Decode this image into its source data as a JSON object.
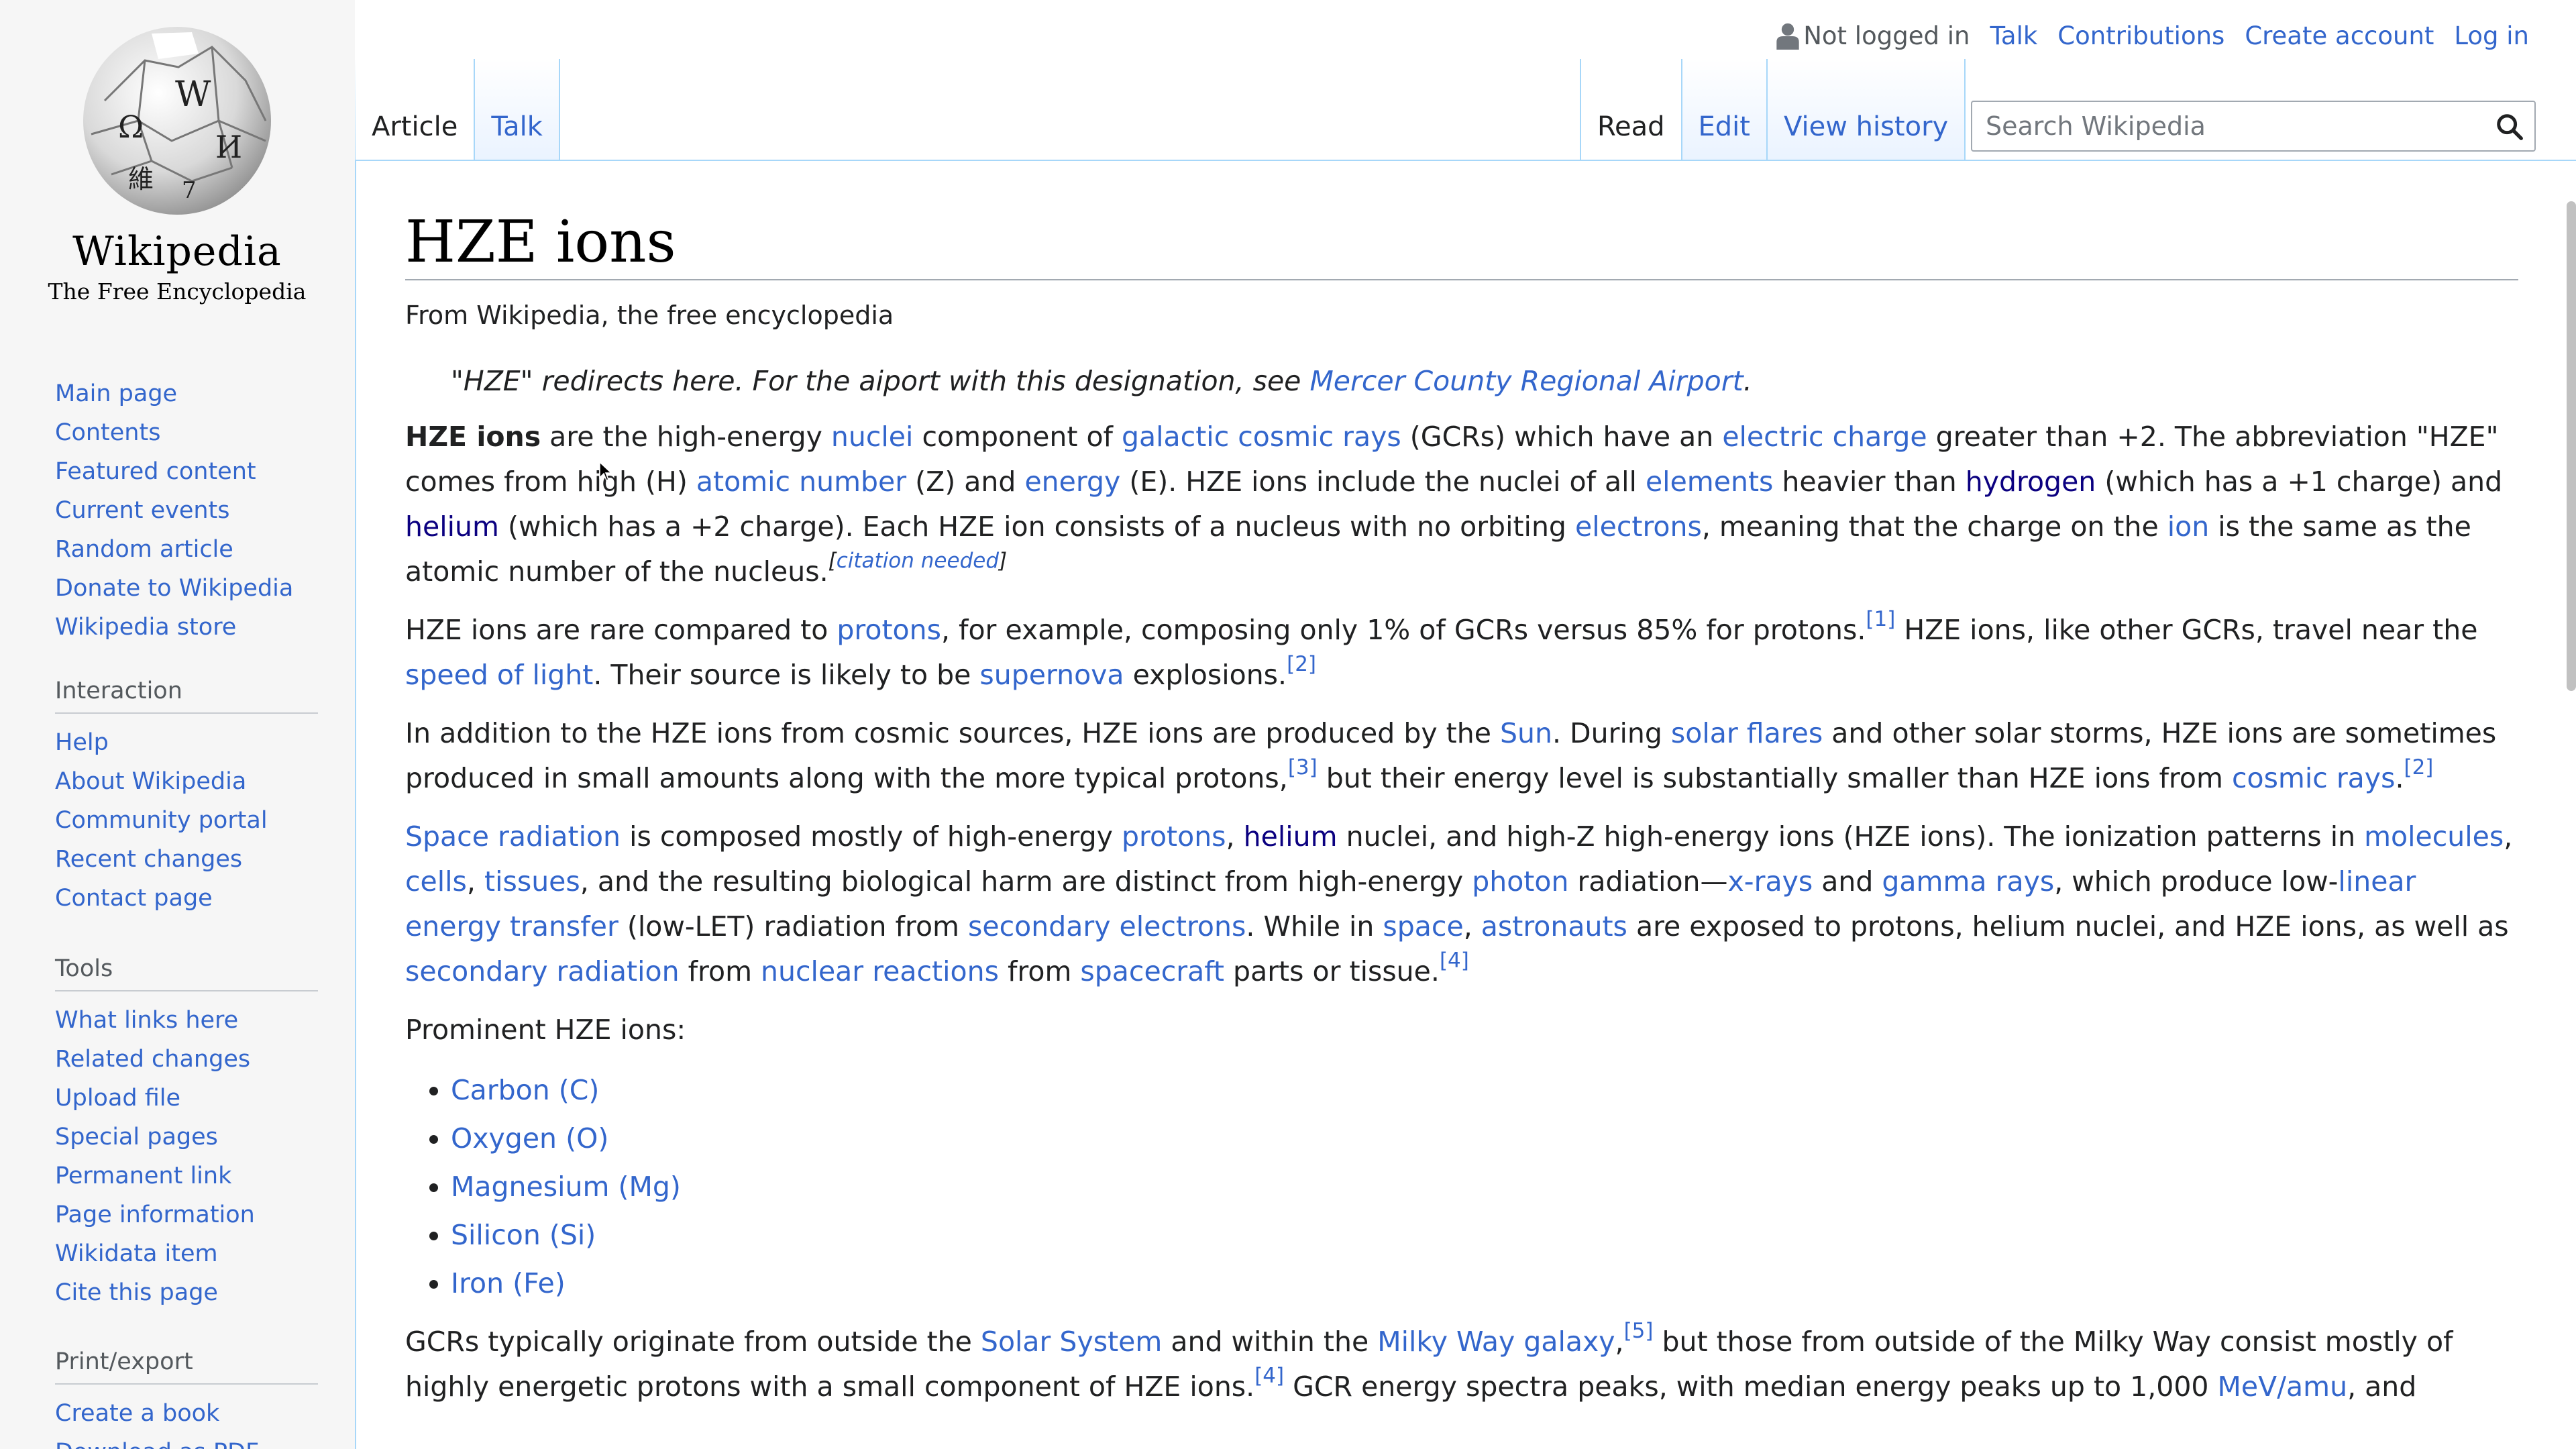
{
  "site": {
    "wordmark": "Wikipedia",
    "tagline": "The Free Encyclopedia"
  },
  "personal": {
    "status": "Not logged in",
    "talk": "Talk",
    "contributions": "Contributions",
    "create_account": "Create account",
    "log_in": "Log in"
  },
  "tabs": {
    "article": "Article",
    "talk": "Talk",
    "read": "Read",
    "edit": "Edit",
    "history": "View history"
  },
  "search": {
    "placeholder": "Search Wikipedia"
  },
  "navigation": {
    "items": [
      "Main page",
      "Contents",
      "Featured content",
      "Current events",
      "Random article",
      "Donate to Wikipedia",
      "Wikipedia store"
    ]
  },
  "interaction": {
    "heading": "Interaction",
    "items": [
      "Help",
      "About Wikipedia",
      "Community portal",
      "Recent changes",
      "Contact page"
    ]
  },
  "tools": {
    "heading": "Tools",
    "items": [
      "What links here",
      "Related changes",
      "Upload file",
      "Special pages",
      "Permanent link",
      "Page information",
      "Wikidata item",
      "Cite this page"
    ]
  },
  "print": {
    "heading": "Print/export",
    "items": [
      "Create a book",
      "Download as PDF"
    ]
  },
  "article": {
    "title": "HZE ions",
    "site_sub": "From Wikipedia, the free encyclopedia",
    "hatnote": {
      "text": "\"HZE\" redirects here. For the aiport with this designation, see ",
      "link": "Mercer County Regional Airport",
      "end": "."
    },
    "p1": {
      "bold": "HZE ions",
      "t1": " are the high-energy ",
      "l_nuclei": "nuclei",
      "t2": " component of ",
      "l_gcr": "galactic cosmic rays",
      "t3": " (GCRs) which have an ",
      "l_charge": "electric charge",
      "t4": " greater than +2. The abbreviation \"HZE\" comes from high (H) ",
      "l_atomic": "atomic number",
      "t5": " (Z) and ",
      "l_energy": "energy",
      "t6": " (E). HZE ions include the nuclei of all ",
      "l_elements": "elements",
      "t7": " heavier than ",
      "l_hydrogen": "hydrogen",
      "t8": " (which has a +1 charge) and ",
      "l_helium": "helium",
      "t9": " (which has a +2 charge). Each HZE ion consists of a nucleus with no orbiting ",
      "l_electrons": "electrons",
      "t10": ", meaning that the charge on the ",
      "l_ion": "ion",
      "t11": " is the same as the atomic number of the nucleus.",
      "cn_open": "[",
      "cn": "citation needed",
      "cn_close": "]"
    },
    "p2": {
      "t1": "HZE ions are rare compared to ",
      "l_protons": "protons",
      "t2": ", for example, composing only 1% of GCRs versus 85% for protons.",
      "ref1": "[1]",
      "t3": " HZE ions, like other GCRs, travel near the ",
      "l_sol": "speed of light",
      "t4": ". Their source is likely to be ",
      "l_supernova": "supernova",
      "t5": " explosions.",
      "ref2": "[2]"
    },
    "p3": {
      "t1": "In addition to the HZE ions from cosmic sources, HZE ions are produced by the ",
      "l_sun": "Sun",
      "t2": ". During ",
      "l_flares": "solar flares",
      "t3": " and other solar storms, HZE ions are sometimes produced in small amounts along with the more typical protons,",
      "ref3": "[3]",
      "t4": " but their energy level is substantially smaller than HZE ions from ",
      "l_cosmic": "cosmic rays",
      "t5": ".",
      "ref2": "[2]"
    },
    "p4": {
      "l_space_rad": "Space radiation",
      "t1": " is composed mostly of high-energy ",
      "l_protons": "protons",
      "t2": ", ",
      "l_helium": "helium",
      "t3": " nuclei, and high-Z high-energy ions (HZE ions). The ionization patterns in ",
      "l_molecules": "molecules",
      "t4": ", ",
      "l_cells": "cells",
      "t5": ", ",
      "l_tissues": "tissues",
      "t6": ", and the resulting biological harm are distinct from high-energy ",
      "l_photon": "photon",
      "t7": " radiation—",
      "l_xrays": "x-rays",
      "t8": " and ",
      "l_gamma": "gamma rays",
      "t9": ", which produce low-",
      "l_let": "linear energy transfer",
      "t10": " (low-LET) radiation from ",
      "l_secondary": "secondary electrons",
      "t11": ". While in ",
      "l_space": "space",
      "t12": ", ",
      "l_astronauts": "astronauts",
      "t13": " are exposed to protons, helium nuclei, and HZE ions, as well as ",
      "l_secrad": "secondary radiation",
      "t14": " from ",
      "l_nuclear": "nuclear reactions",
      "t15": " from ",
      "l_spacecraft": "spacecraft",
      "t16": " parts or tissue.",
      "ref4": "[4]"
    },
    "prominent_label": "Prominent HZE ions:",
    "ions": [
      "Carbon (C)",
      "Oxygen (O)",
      "Magnesium (Mg)",
      "Silicon (Si)",
      "Iron (Fe)"
    ],
    "p5": {
      "t1": "GCRs typically originate from outside the ",
      "l_solar_system": "Solar System",
      "t2": " and within the ",
      "l_milky": "Milky Way galaxy",
      "t3": ",",
      "ref5": "[5]",
      "t4": " but those from outside of the Milky Way consist mostly of highly energetic protons with a small component of HZE ions.",
      "ref4": "[4]",
      "t5": " GCR energy spectra peaks, with median energy peaks up to 1,000 ",
      "l_mev": "MeV/amu",
      "t6": ", and"
    }
  }
}
